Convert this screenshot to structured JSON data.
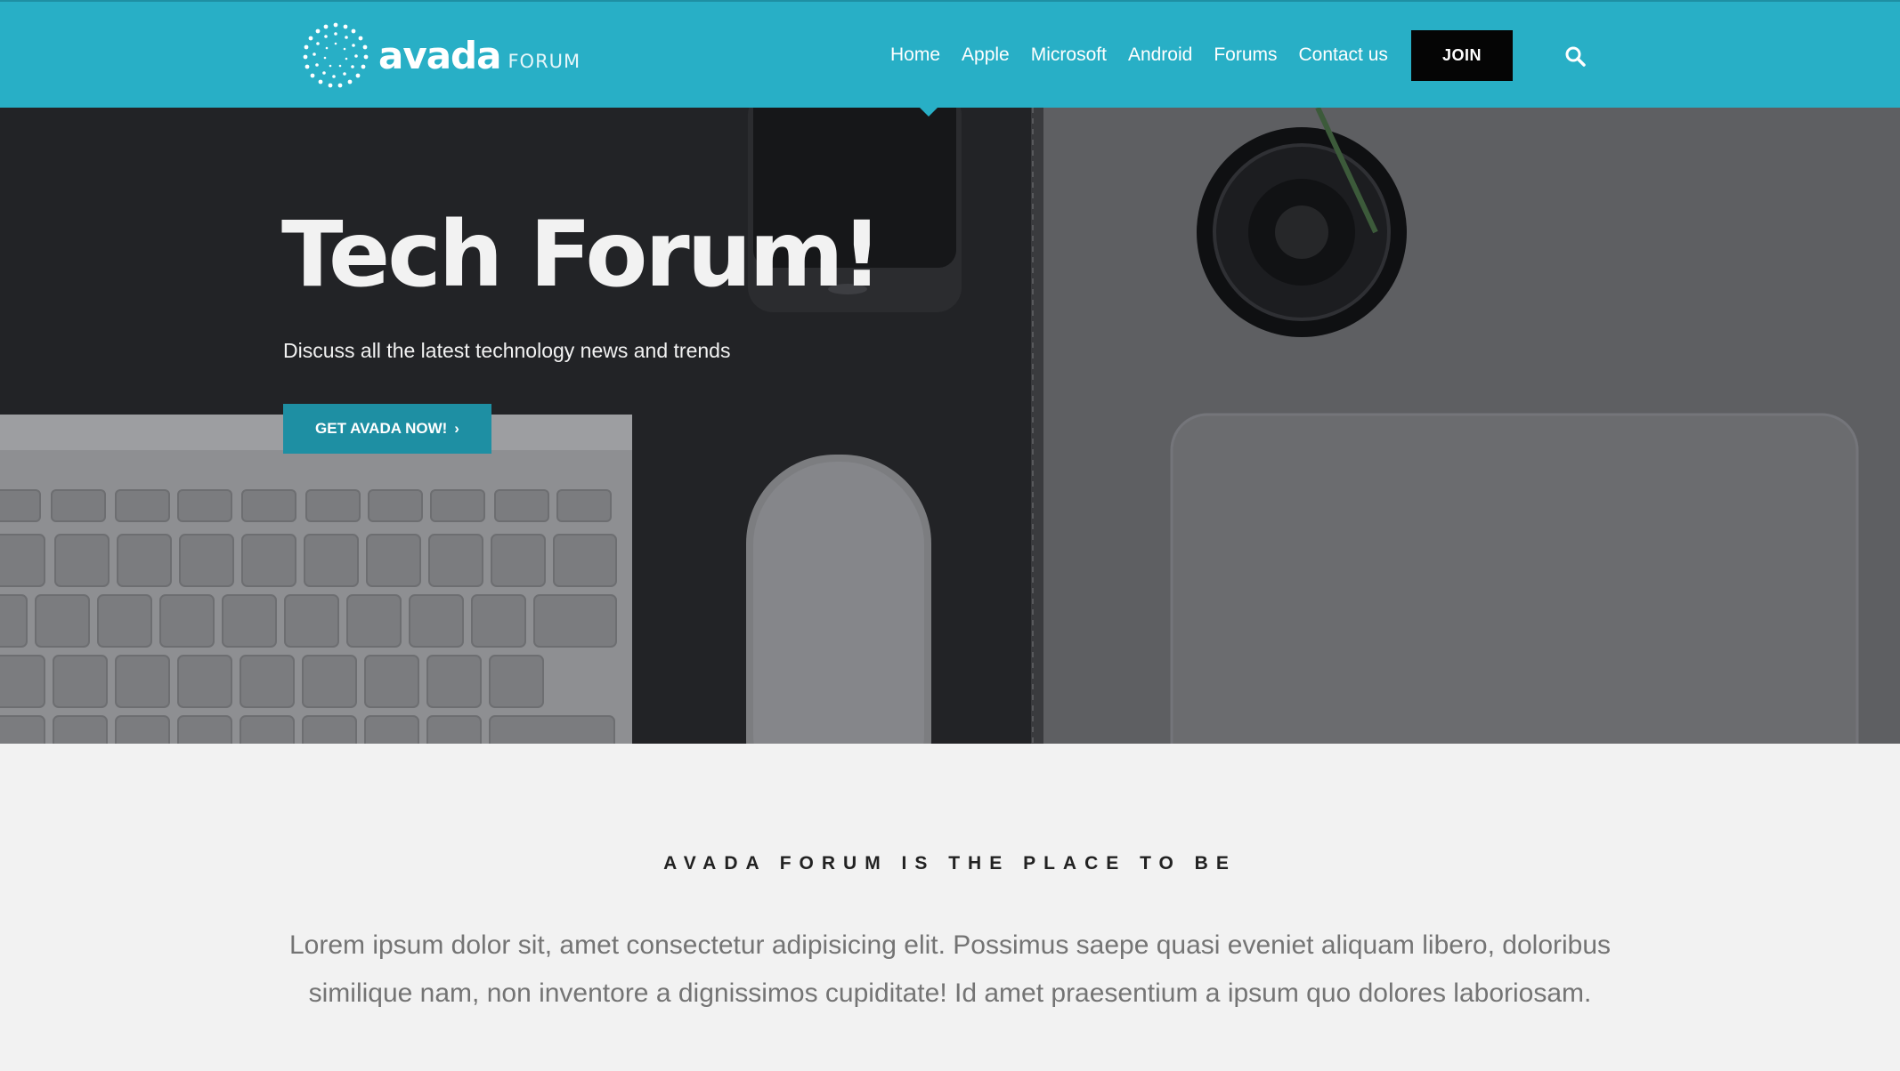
{
  "header": {
    "logo": {
      "word": "avada",
      "sub": "FORUM"
    },
    "nav": [
      "Home",
      "Apple",
      "Microsoft",
      "Android",
      "Forums",
      "Contact us"
    ],
    "join_label": "JOIN",
    "colors": {
      "bar": "#28afc6",
      "join": "#050505"
    }
  },
  "hero": {
    "title": "Tech Forum!",
    "subtitle": "Discuss all the latest technology news and trends",
    "cta_label": "GET AVADA NOW!",
    "cta_color": "#1e8fa3"
  },
  "intro": {
    "heading": "AVADA FORUM IS THE PLACE TO BE",
    "text": "Lorem ipsum dolor sit, amet consectetur adipisicing elit. Possimus saepe quasi eveniet aliquam libero, doloribus similique nam, non inventore a dignissimos cupiditate! Id amet praesentium a ipsum quo dolores laboriosam."
  },
  "icons": [
    "logo-ring-icon",
    "search-icon",
    "chevron-right-icon"
  ]
}
